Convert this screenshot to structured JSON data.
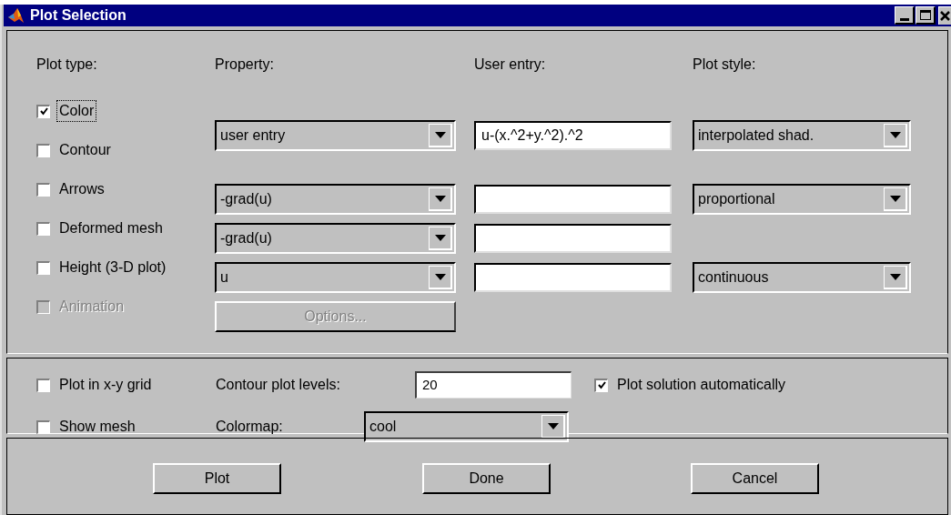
{
  "window": {
    "title": "Plot Selection"
  },
  "headers": [
    "Plot type:",
    "Property:",
    "User entry:",
    "Plot style:"
  ],
  "plot_types": [
    {
      "label": "Color",
      "checked": true,
      "disabled": false,
      "focused": true
    },
    {
      "label": "Contour",
      "checked": false,
      "disabled": false,
      "focused": false
    },
    {
      "label": "Arrows",
      "checked": false,
      "disabled": false,
      "focused": false
    },
    {
      "label": "Deformed mesh",
      "checked": false,
      "disabled": false,
      "focused": false
    },
    {
      "label": "Height (3-D plot)",
      "checked": false,
      "disabled": false,
      "focused": false
    },
    {
      "label": "Animation",
      "checked": false,
      "disabled": true,
      "focused": false
    }
  ],
  "property_rows": [
    {
      "property": {
        "kind": "dropdown",
        "value": "user entry"
      },
      "user_entry": "u-(x.^2+y.^2).^2",
      "plot_style": "interpolated shad."
    },
    {
      "property": {
        "kind": "dropdown",
        "value": "-grad(u)"
      },
      "user_entry": "",
      "plot_style": "proportional"
    },
    {
      "property": {
        "kind": "dropdown",
        "value": "-grad(u)"
      },
      "user_entry": ""
    },
    {
      "property": {
        "kind": "dropdown",
        "value": "u"
      },
      "user_entry": "",
      "plot_style": "continuous"
    },
    {
      "property": {
        "kind": "button",
        "label": "Options...",
        "disabled": true
      }
    }
  ],
  "options": {
    "plot_in_grid": {
      "label": "Plot in x-y grid",
      "checked": false
    },
    "show_mesh": {
      "label": "Show mesh",
      "checked": false
    },
    "contour_levels": {
      "label": "Contour plot levels:",
      "value": "20"
    },
    "colormap": {
      "label": "Colormap:",
      "value": "cool"
    },
    "plot_automatically": {
      "label": "Plot solution automatically",
      "checked": true
    }
  },
  "buttons": [
    "Plot",
    "Done",
    "Cancel"
  ]
}
